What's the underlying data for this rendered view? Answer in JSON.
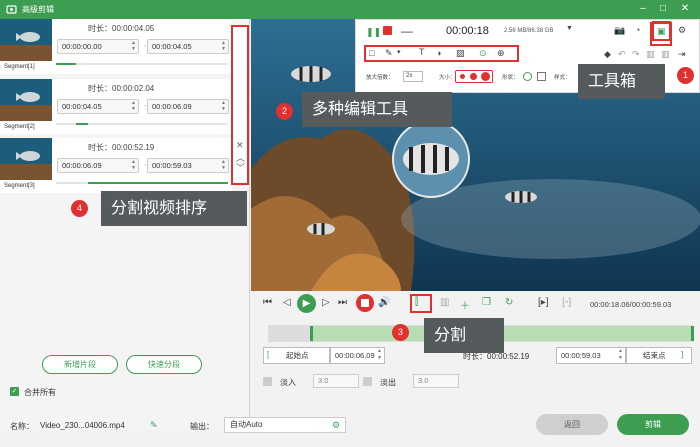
{
  "window": {
    "title": "高级剪辑"
  },
  "segments": [
    {
      "label": "Segment[1]",
      "duration": "时长：00:00:04.05",
      "start": "00:00:00.00",
      "end": "00:00:04.05"
    },
    {
      "label": "Segment[2]",
      "duration": "时长：00:00:02.04",
      "start": "00:00:04.05",
      "end": "00:00:06.09"
    },
    {
      "label": "Segment[3]",
      "duration": "时长：00:00:52.19",
      "start": "00:00:06.09",
      "end": "00:00:59.03"
    }
  ],
  "left_buttons": {
    "add_segment": "新增片段",
    "quick_split": "快速分段"
  },
  "merge_all": "合并所有",
  "toolbar": {
    "record_time": "00:00:18",
    "disk": "2.56 MB/86.38 GB",
    "zoom_label": "放大倍数：",
    "zoom_value": "2x",
    "size_label": "大小：",
    "shape_label": "形状：",
    "style_label": "样式："
  },
  "callouts": {
    "toolbox": "工具箱",
    "edit_tools": "多种编辑工具",
    "split": "分割",
    "sort": "分割视频排序"
  },
  "badges": [
    "1",
    "2",
    "3",
    "4"
  ],
  "playback": {
    "time": "00:00:18.06/00:00:59.03"
  },
  "trim": {
    "start_label": "起始点",
    "start_time": "00:00:06.09",
    "duration": "时长：00:00:52.19",
    "end_time": "00:00:59.03",
    "end_label": "结束点"
  },
  "fade": {
    "fade_in_label": "淡入",
    "fade_in_value": "3.0",
    "fade_out_label": "淡出",
    "fade_out_value": "3.0"
  },
  "output": {
    "name_label": "名称：",
    "name_value": "Video_230...04006.mp4",
    "output_label": "输出：",
    "output_value": "自动Auto"
  },
  "buttons": {
    "back": "返回",
    "edit": "剪辑"
  },
  "colors": {
    "accent": "#3d9e52",
    "highlight": "#e03030"
  }
}
